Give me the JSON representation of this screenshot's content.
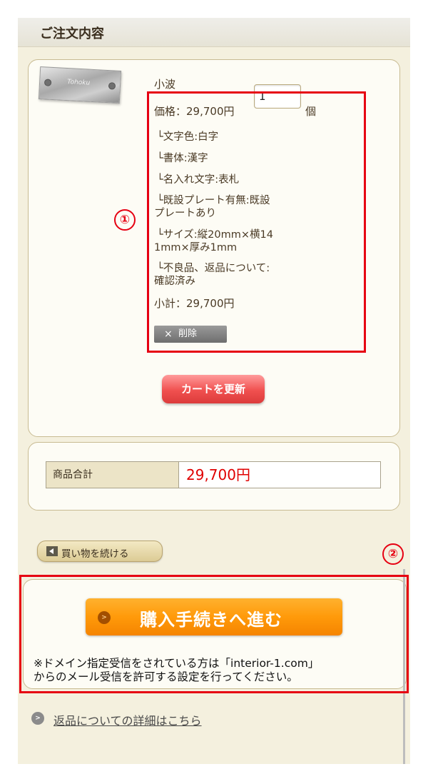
{
  "header": {
    "title": "ご注文内容"
  },
  "item": {
    "thumbnail_text": "Tohoku",
    "name": "小波",
    "price_label": "価格：29,700円",
    "quantity": "1",
    "unit": "個",
    "options": [
      [
        "└文字色:白字"
      ],
      [
        "└書体:漢字"
      ],
      [
        "└名入れ文字:表札"
      ],
      [
        "└既設プレート有無:既設",
        "プレートあり"
      ],
      [
        "└サイズ:縦20mm×横14",
        "1mm×厚み1mm"
      ],
      [
        "└不良品、返品について:",
        "確認済み"
      ]
    ],
    "subtotal": "小計：29,700円",
    "delete_icon": "×",
    "delete_label": "削除"
  },
  "update_button": "カートを更新",
  "totals": {
    "label": "商品合計",
    "value": "29,700円"
  },
  "continue_button": "買い物を続ける",
  "checkout": {
    "button_label": "購入手続きへ進む",
    "button_icon": ">",
    "notice_line1": "※ドメイン指定受信をされている方は「interior-1.com」",
    "notice_line2": "からのメール受信を許可する設定を行ってください。"
  },
  "returns_link": {
    "icon": ">",
    "label": "返品についての詳細はこちら"
  },
  "annotations": {
    "marker1": "①",
    "marker2": "②",
    "color": "#e60012"
  }
}
